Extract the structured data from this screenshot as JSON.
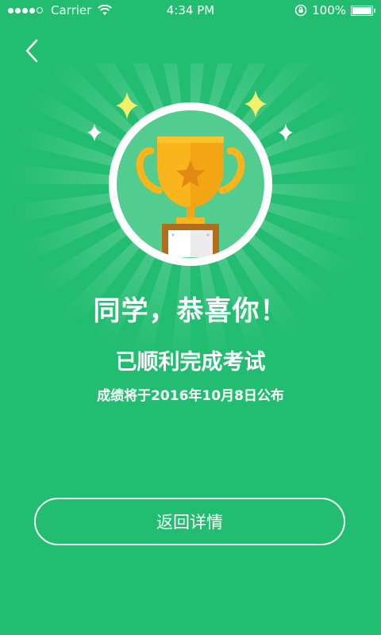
{
  "status_bar": {
    "carrier": "Carrier",
    "time": "4:34 PM",
    "battery": "100%"
  },
  "icons": {
    "back": "chevron-left-icon",
    "trophy": "trophy-icon",
    "sparkle": "sparkle-icon",
    "wifi": "wifi-icon",
    "lock": "rotation-lock-icon",
    "battery": "battery-icon"
  },
  "colors": {
    "background": "#22bd70",
    "trophy_gold": "#f9b51b",
    "circle_fill": "#52cc8f",
    "sparkle_yellow": "#f5f06a"
  },
  "content": {
    "title": "同学，恭喜你！",
    "subtitle": "已顺利完成考试",
    "note": "成绩将于2016年10月8日公布"
  },
  "actions": {
    "return_label": "返回详情"
  }
}
